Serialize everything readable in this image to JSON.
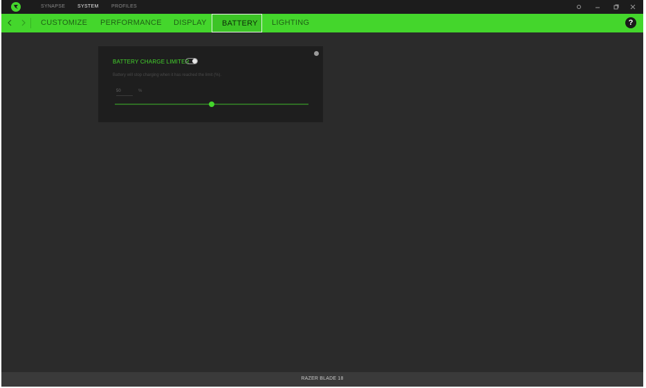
{
  "titlebar": {
    "tabs": [
      {
        "label": "SYNAPSE",
        "active": false
      },
      {
        "label": "SYSTEM",
        "active": true
      },
      {
        "label": "PROFILES",
        "active": false
      }
    ],
    "controls": {
      "settings_icon": "gear-icon",
      "minimize_icon": "minimize-icon",
      "restore_icon": "restore-icon",
      "close_icon": "close-icon"
    }
  },
  "nav": {
    "back_icon": "chevron-left-icon",
    "forward_icon": "chevron-right-icon",
    "tabs": [
      {
        "label": "CUSTOMIZE",
        "active": false
      },
      {
        "label": "PERFORMANCE",
        "active": false
      },
      {
        "label": "DISPLAY",
        "active": false
      },
      {
        "label": "BATTERY",
        "active": true
      },
      {
        "label": "LIGHTING",
        "active": false
      }
    ],
    "help_label": "?"
  },
  "battery_card": {
    "title": "BATTERY CHARGE LIMITER",
    "toggle_on": true,
    "description": "Battery will stop charging when it has reached the limit (%).",
    "limit_value": "50",
    "limit_unit": "%",
    "slider_fraction": 0.5,
    "slider_min": "",
    "slider_mid": "",
    "slider_max": ""
  },
  "footer": {
    "device_name": "RAZER BLADE 18"
  },
  "colors": {
    "accent": "#44d62c",
    "background": "#2b2b2b",
    "card": "#1e1e1e"
  }
}
